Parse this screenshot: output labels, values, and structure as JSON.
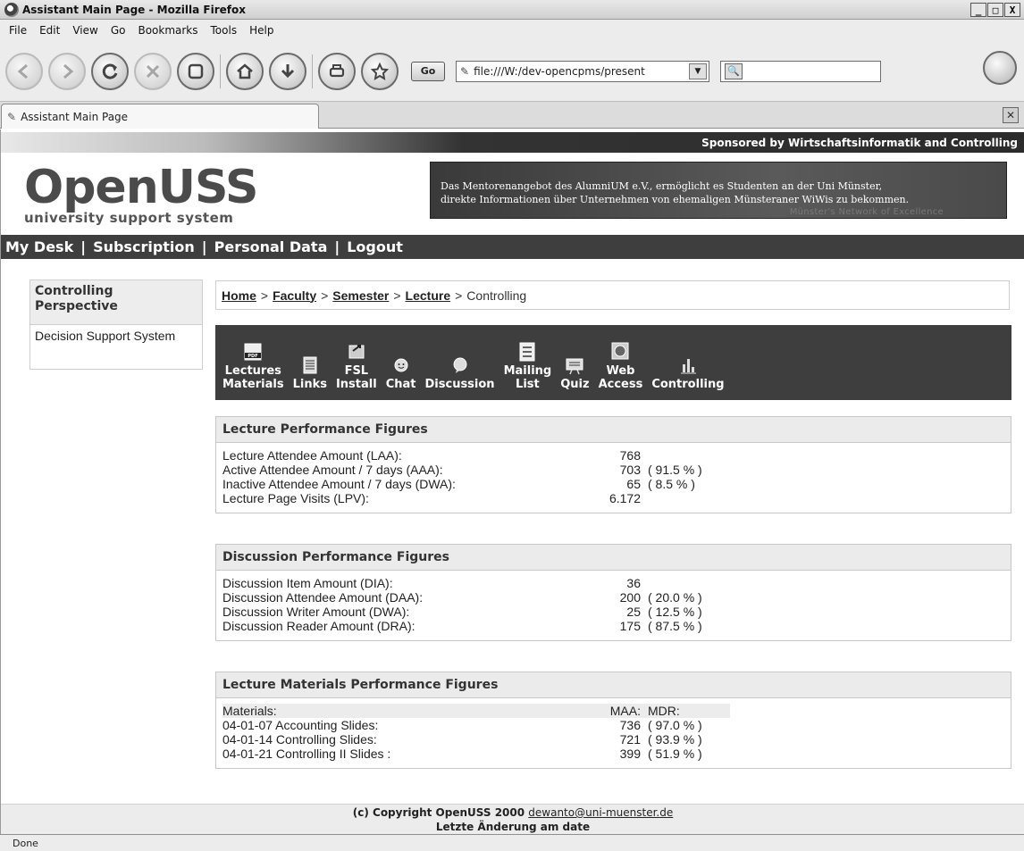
{
  "window": {
    "title": "Assistant Main Page - Mozilla Firefox",
    "controls": [
      "_",
      "□",
      "X"
    ]
  },
  "menubar": {
    "items": [
      "File",
      "Edit",
      "View",
      "Go",
      "Bookmarks",
      "Tools",
      "Help"
    ]
  },
  "navbar": {
    "go_label": "Go",
    "url": "file:///W:/dev-opencpms/present",
    "search_placeholder": ""
  },
  "tabs": [
    {
      "label": "Assistant Main Page"
    }
  ],
  "page": {
    "sponsor": "Sponsored by Wirtschaftsinformatik and Controlling",
    "logo": {
      "main_left": "Open",
      "main_right": "USS",
      "sub": "university support system"
    },
    "banner": {
      "line1": "Das Mentorenangebot des AlumniUM e.V., ermöglicht es Studenten an der Uni Münster,",
      "line2": "direkte Informationen über Unternehmen von ehemaligen Münsteraner WiWis zu bekommen.",
      "ghost": "Münster's Network of Excellence"
    },
    "site_nav": [
      "My Desk",
      "Subscription",
      "Personal Data",
      "Logout"
    ],
    "sidebar": [
      {
        "label": "Controlling Perspective",
        "active": true
      },
      {
        "label": "Decision Support System",
        "active": false
      }
    ],
    "breadcrumb": {
      "links": [
        "Home",
        "Faculty",
        "Semester",
        "Lecture"
      ],
      "current": "Controlling"
    },
    "toolbar": [
      {
        "label1": "Lectures",
        "label2": "Materials",
        "icon": "pdf-icon"
      },
      {
        "label1": "Links",
        "label2": "",
        "icon": "links-icon"
      },
      {
        "label1": "FSL",
        "label2": "Install",
        "icon": "install-icon"
      },
      {
        "label1": "Chat",
        "label2": "",
        "icon": "chat-icon"
      },
      {
        "label1": "Discussion",
        "label2": "",
        "icon": "discussion-icon"
      },
      {
        "label1": "Mailing",
        "label2": "List",
        "icon": "mailing-list-icon"
      },
      {
        "label1": "Quiz",
        "label2": "",
        "icon": "quiz-icon"
      },
      {
        "label1": "Web",
        "label2": "Access",
        "icon": "globe-icon"
      },
      {
        "label1": "Controlling",
        "label2": "",
        "icon": "bar-chart-icon"
      }
    ],
    "lecture_figures": {
      "title": "Lecture Performance Figures",
      "rows": [
        {
          "label": "Lecture Attendee Amount (LAA):",
          "value": "768",
          "pct": ""
        },
        {
          "label": "Active Attendee Amount / 7 days (AAA):",
          "value": "703",
          "pct": "( 91.5 % )"
        },
        {
          "label": "Inactive Attendee Amount / 7 days (DWA):",
          "value": "65",
          "pct": "( 8.5 % )"
        },
        {
          "label": "Lecture Page Visits (LPV):",
          "value": "6.172",
          "pct": ""
        }
      ]
    },
    "discussion_figures": {
      "title": "Discussion Performance Figures",
      "rows": [
        {
          "label": "Discussion Item Amount (DIA):",
          "value": "36",
          "pct": ""
        },
        {
          "label": "Discussion Attendee Amount (DAA):",
          "value": "200",
          "pct": "( 20.0 % )"
        },
        {
          "label": "Discussion Writer Amount (DWA):",
          "value": "25",
          "pct": "( 12.5 % )"
        },
        {
          "label": "Discussion Reader Amount (DRA):",
          "value": "175",
          "pct": "( 87.5 % )"
        }
      ]
    },
    "materials_figures": {
      "title": "Lecture Materials Performance Figures",
      "header": {
        "label": "Materials:",
        "value": "MAA:",
        "pct": "MDR:"
      },
      "rows": [
        {
          "label": "04-01-07 Accounting Slides:",
          "value": "736",
          "pct": "( 97.0 % )"
        },
        {
          "label": "04-01-14 Controlling Slides:",
          "value": "721",
          "pct": "( 93.9 % )"
        },
        {
          "label": "04-01-21 Controlling II Slides :",
          "value": "399",
          "pct": "( 51.9 % )"
        }
      ]
    },
    "footer": {
      "copyright": "(c) Copyright OpenUSS 2000",
      "email": "dewanto@uni-muenster.de",
      "last_change": "Letzte Änderung am date"
    }
  },
  "statusbar": {
    "text": "Done"
  }
}
